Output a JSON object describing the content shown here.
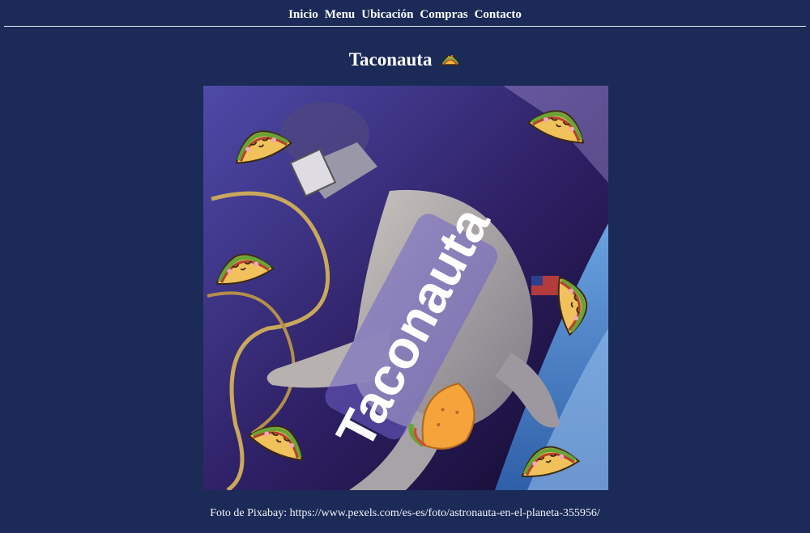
{
  "nav": {
    "items": [
      "Inicio",
      "Menu",
      "Ubicación",
      "Compras",
      "Contacto"
    ]
  },
  "page": {
    "title": "Taconauta"
  },
  "hero": {
    "overlay_text": "Taconauta"
  },
  "caption": "Foto de Pixabay: https://www.pexels.com/es-es/foto/astronauta-en-el-planeta-355956/",
  "colors": {
    "background": "#1b2a57",
    "text": "#ffffff",
    "image_purple": "#4b3a9e",
    "earth_blue": "#3b73c4"
  }
}
